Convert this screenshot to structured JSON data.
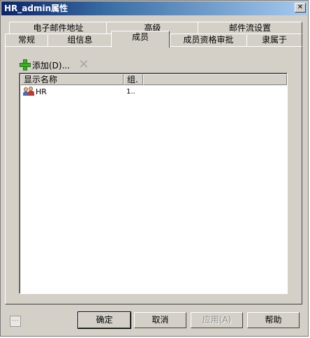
{
  "window": {
    "title": "HR_admin属性"
  },
  "tabs_row1": [
    {
      "label": "电子邮件地址"
    },
    {
      "label": "高级"
    },
    {
      "label": "邮件流设置"
    }
  ],
  "tabs_row2": [
    {
      "label": "常规"
    },
    {
      "label": "组信息"
    },
    {
      "label": "成员",
      "active": true
    },
    {
      "label": "成员资格审批"
    },
    {
      "label": "隶属于"
    }
  ],
  "toolbar": {
    "add_label": "添加(D)..."
  },
  "list": {
    "columns": [
      "显示名称",
      "组.",
      ""
    ],
    "rows": [
      {
        "name": "HR",
        "type": "1.."
      }
    ]
  },
  "buttons": {
    "ok": "确定",
    "cancel": "取消",
    "apply": "应用(A)",
    "help": "帮助"
  }
}
